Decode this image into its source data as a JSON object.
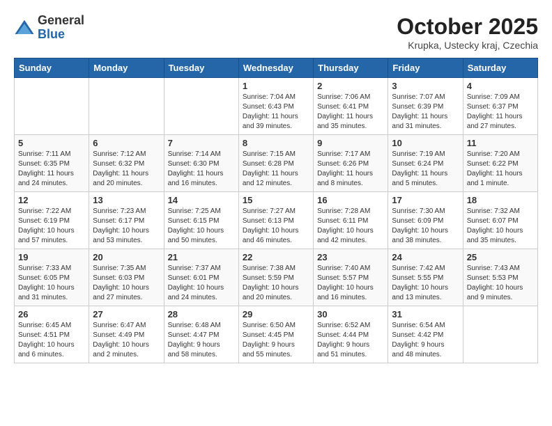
{
  "header": {
    "logo": {
      "general": "General",
      "blue": "Blue"
    },
    "title": "October 2025",
    "location": "Krupka, Ustecky kraj, Czechia"
  },
  "weekdays": [
    "Sunday",
    "Monday",
    "Tuesday",
    "Wednesday",
    "Thursday",
    "Friday",
    "Saturday"
  ],
  "weeks": [
    [
      {
        "day": "",
        "content": ""
      },
      {
        "day": "",
        "content": ""
      },
      {
        "day": "",
        "content": ""
      },
      {
        "day": "1",
        "content": "Sunrise: 7:04 AM\nSunset: 6:43 PM\nDaylight: 11 hours\nand 39 minutes."
      },
      {
        "day": "2",
        "content": "Sunrise: 7:06 AM\nSunset: 6:41 PM\nDaylight: 11 hours\nand 35 minutes."
      },
      {
        "day": "3",
        "content": "Sunrise: 7:07 AM\nSunset: 6:39 PM\nDaylight: 11 hours\nand 31 minutes."
      },
      {
        "day": "4",
        "content": "Sunrise: 7:09 AM\nSunset: 6:37 PM\nDaylight: 11 hours\nand 27 minutes."
      }
    ],
    [
      {
        "day": "5",
        "content": "Sunrise: 7:11 AM\nSunset: 6:35 PM\nDaylight: 11 hours\nand 24 minutes."
      },
      {
        "day": "6",
        "content": "Sunrise: 7:12 AM\nSunset: 6:32 PM\nDaylight: 11 hours\nand 20 minutes."
      },
      {
        "day": "7",
        "content": "Sunrise: 7:14 AM\nSunset: 6:30 PM\nDaylight: 11 hours\nand 16 minutes."
      },
      {
        "day": "8",
        "content": "Sunrise: 7:15 AM\nSunset: 6:28 PM\nDaylight: 11 hours\nand 12 minutes."
      },
      {
        "day": "9",
        "content": "Sunrise: 7:17 AM\nSunset: 6:26 PM\nDaylight: 11 hours\nand 8 minutes."
      },
      {
        "day": "10",
        "content": "Sunrise: 7:19 AM\nSunset: 6:24 PM\nDaylight: 11 hours\nand 5 minutes."
      },
      {
        "day": "11",
        "content": "Sunrise: 7:20 AM\nSunset: 6:22 PM\nDaylight: 11 hours\nand 1 minute."
      }
    ],
    [
      {
        "day": "12",
        "content": "Sunrise: 7:22 AM\nSunset: 6:19 PM\nDaylight: 10 hours\nand 57 minutes."
      },
      {
        "day": "13",
        "content": "Sunrise: 7:23 AM\nSunset: 6:17 PM\nDaylight: 10 hours\nand 53 minutes."
      },
      {
        "day": "14",
        "content": "Sunrise: 7:25 AM\nSunset: 6:15 PM\nDaylight: 10 hours\nand 50 minutes."
      },
      {
        "day": "15",
        "content": "Sunrise: 7:27 AM\nSunset: 6:13 PM\nDaylight: 10 hours\nand 46 minutes."
      },
      {
        "day": "16",
        "content": "Sunrise: 7:28 AM\nSunset: 6:11 PM\nDaylight: 10 hours\nand 42 minutes."
      },
      {
        "day": "17",
        "content": "Sunrise: 7:30 AM\nSunset: 6:09 PM\nDaylight: 10 hours\nand 38 minutes."
      },
      {
        "day": "18",
        "content": "Sunrise: 7:32 AM\nSunset: 6:07 PM\nDaylight: 10 hours\nand 35 minutes."
      }
    ],
    [
      {
        "day": "19",
        "content": "Sunrise: 7:33 AM\nSunset: 6:05 PM\nDaylight: 10 hours\nand 31 minutes."
      },
      {
        "day": "20",
        "content": "Sunrise: 7:35 AM\nSunset: 6:03 PM\nDaylight: 10 hours\nand 27 minutes."
      },
      {
        "day": "21",
        "content": "Sunrise: 7:37 AM\nSunset: 6:01 PM\nDaylight: 10 hours\nand 24 minutes."
      },
      {
        "day": "22",
        "content": "Sunrise: 7:38 AM\nSunset: 5:59 PM\nDaylight: 10 hours\nand 20 minutes."
      },
      {
        "day": "23",
        "content": "Sunrise: 7:40 AM\nSunset: 5:57 PM\nDaylight: 10 hours\nand 16 minutes."
      },
      {
        "day": "24",
        "content": "Sunrise: 7:42 AM\nSunset: 5:55 PM\nDaylight: 10 hours\nand 13 minutes."
      },
      {
        "day": "25",
        "content": "Sunrise: 7:43 AM\nSunset: 5:53 PM\nDaylight: 10 hours\nand 9 minutes."
      }
    ],
    [
      {
        "day": "26",
        "content": "Sunrise: 6:45 AM\nSunset: 4:51 PM\nDaylight: 10 hours\nand 6 minutes."
      },
      {
        "day": "27",
        "content": "Sunrise: 6:47 AM\nSunset: 4:49 PM\nDaylight: 10 hours\nand 2 minutes."
      },
      {
        "day": "28",
        "content": "Sunrise: 6:48 AM\nSunset: 4:47 PM\nDaylight: 9 hours\nand 58 minutes."
      },
      {
        "day": "29",
        "content": "Sunrise: 6:50 AM\nSunset: 4:45 PM\nDaylight: 9 hours\nand 55 minutes."
      },
      {
        "day": "30",
        "content": "Sunrise: 6:52 AM\nSunset: 4:44 PM\nDaylight: 9 hours\nand 51 minutes."
      },
      {
        "day": "31",
        "content": "Sunrise: 6:54 AM\nSunset: 4:42 PM\nDaylight: 9 hours\nand 48 minutes."
      },
      {
        "day": "",
        "content": ""
      }
    ]
  ]
}
